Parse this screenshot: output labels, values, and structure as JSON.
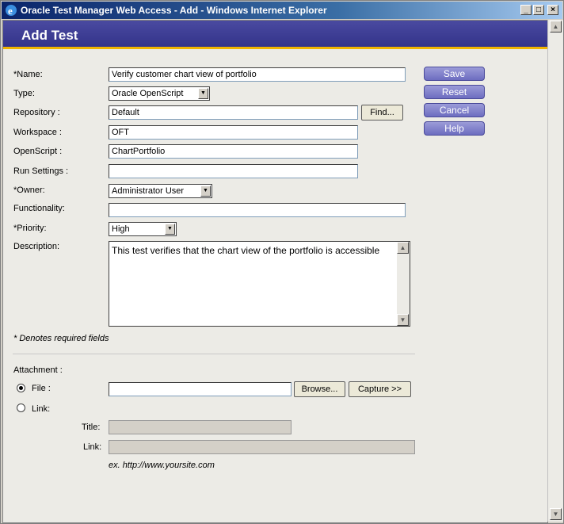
{
  "window": {
    "title": "Oracle Test Manager Web Access - Add - Windows Internet Explorer",
    "controls": {
      "minimize": "_",
      "maximize": "□",
      "close": "×"
    }
  },
  "page": {
    "heading": "Add Test"
  },
  "form": {
    "name": {
      "label": "*Name:",
      "value": "Verify customer chart view of portfolio"
    },
    "type": {
      "label": "Type:",
      "value": "Oracle OpenScript"
    },
    "repository": {
      "label": "Repository :",
      "value": "Default",
      "find_label": "Find..."
    },
    "workspace": {
      "label": "Workspace :",
      "value": "OFT"
    },
    "openscript": {
      "label": "OpenScript :",
      "value": "ChartPortfolio"
    },
    "run_settings": {
      "label": "Run Settings :",
      "value": ""
    },
    "owner": {
      "label": "*Owner:",
      "value": "Administrator User"
    },
    "functionality": {
      "label": "Functionality:",
      "value": ""
    },
    "priority": {
      "label": "*Priority:",
      "value": "High"
    },
    "description": {
      "label": "Description:",
      "value": "This test verifies that the chart view of the portfolio is accessible"
    },
    "required_note": "* Denotes required fields"
  },
  "actions": {
    "save": "Save",
    "reset": "Reset",
    "cancel": "Cancel",
    "help": "Help"
  },
  "attachment": {
    "label": "Attachment :",
    "file_label": "File :",
    "file_value": "",
    "browse_label": "Browse...",
    "capture_label": "Capture >>",
    "link_label": "Link:",
    "title_label": "Title:",
    "link_field_label": "Link:",
    "example": "ex. http://www.yoursite.com",
    "selected": "file"
  },
  "icons": {
    "browser": "ie-icon",
    "dropdown": "chevron-down-icon",
    "scroll_up": "arrow-up-icon",
    "scroll_down": "arrow-down-icon"
  },
  "colors": {
    "banner": "#3a3a95",
    "accent_line": "#f0b400",
    "side_button": "#7b7bcc"
  }
}
